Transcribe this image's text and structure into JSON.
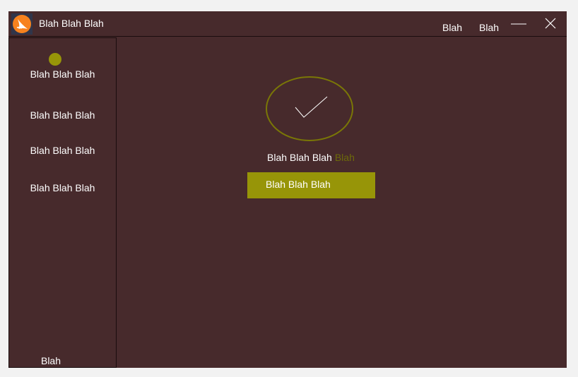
{
  "window": {
    "title": "Blah Blah Blah",
    "app_icon": "orange-logo-icon",
    "header_links": [
      "Blah",
      "Blah"
    ],
    "controls": [
      "minimize-icon",
      "close-icon"
    ]
  },
  "sidebar": {
    "items": [
      {
        "label": "Blah Blah Blah",
        "active": true
      },
      {
        "label": "Blah Blah Blah"
      },
      {
        "label": "Blah Blah Blah"
      },
      {
        "label": "Blah Blah Blah"
      }
    ],
    "footer": "Blah"
  },
  "main": {
    "status_icon": "checkmark-circle-icon",
    "message": "Blah Blah Blah",
    "message_accent": "Blah",
    "button_label": "Blah Blah Blah"
  },
  "colors": {
    "background": "#472a2c",
    "accent": "#979508",
    "accent_dim": "#6d6a0a",
    "text": "#ffffff",
    "logo": "#f7821e"
  }
}
